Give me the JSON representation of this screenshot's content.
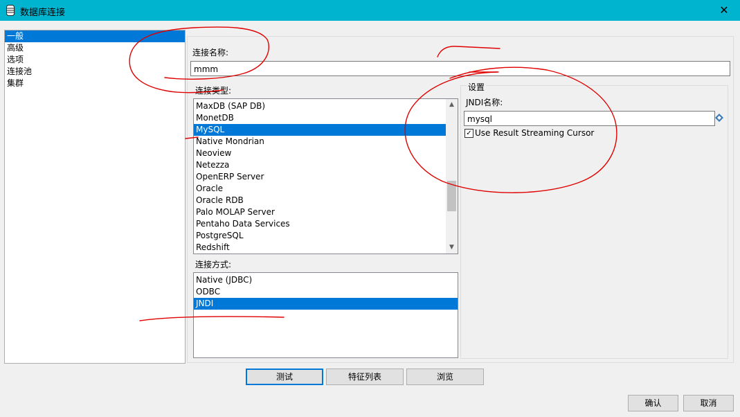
{
  "window": {
    "title": "数据库连接",
    "close_glyph": "✕"
  },
  "categories": [
    {
      "label": "一般",
      "selected": true
    },
    {
      "label": "高级",
      "selected": false
    },
    {
      "label": "选项",
      "selected": false
    },
    {
      "label": "连接池",
      "selected": false
    },
    {
      "label": "集群",
      "selected": false
    }
  ],
  "connection_name": {
    "label": "连接名称:",
    "value": "mmm"
  },
  "connection_type": {
    "label": "连接类型:",
    "items": [
      {
        "label": "MaxDB (SAP DB)",
        "selected": false
      },
      {
        "label": "MonetDB",
        "selected": false
      },
      {
        "label": "MySQL",
        "selected": true
      },
      {
        "label": "Native Mondrian",
        "selected": false
      },
      {
        "label": "Neoview",
        "selected": false
      },
      {
        "label": "Netezza",
        "selected": false
      },
      {
        "label": "OpenERP Server",
        "selected": false
      },
      {
        "label": "Oracle",
        "selected": false
      },
      {
        "label": "Oracle RDB",
        "selected": false
      },
      {
        "label": "Palo MOLAP Server",
        "selected": false
      },
      {
        "label": "Pentaho Data Services",
        "selected": false
      },
      {
        "label": "PostgreSQL",
        "selected": false
      },
      {
        "label": "Redshift",
        "selected": false
      }
    ]
  },
  "access_method": {
    "label": "连接方式:",
    "items": [
      {
        "label": "Native (JDBC)",
        "selected": false
      },
      {
        "label": "ODBC",
        "selected": false
      },
      {
        "label": "JNDI",
        "selected": true
      }
    ]
  },
  "settings": {
    "title": "设置",
    "jndi_label": "JNDI名称:",
    "jndi_value": "mysql",
    "streaming_label": "Use Result Streaming Cursor",
    "streaming_checked": true,
    "check_glyph": "✓"
  },
  "buttons": {
    "test": "测试",
    "features": "特征列表",
    "explore": "浏览",
    "ok": "确认",
    "cancel": "取消"
  },
  "colors": {
    "titlebar": "#00b4d0",
    "selection": "#0078d7",
    "annotation": "#e00000"
  }
}
